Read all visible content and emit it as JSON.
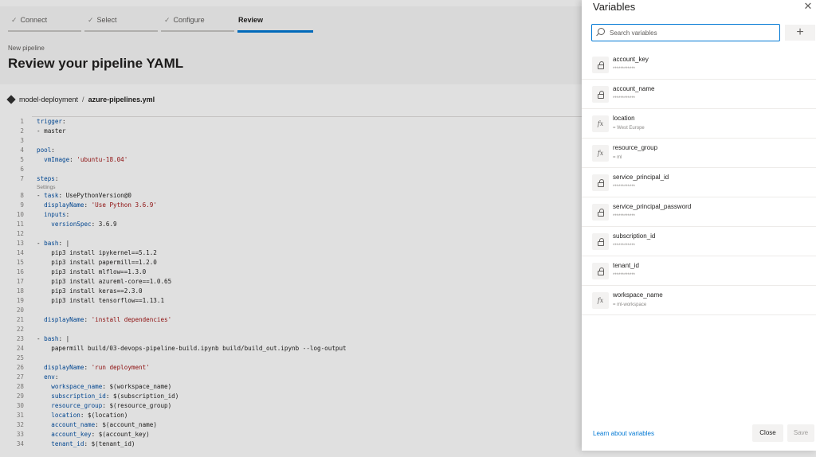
{
  "wizard": {
    "steps": [
      {
        "label": "Connect",
        "checked": true
      },
      {
        "label": "Select",
        "checked": true
      },
      {
        "label": "Configure",
        "checked": true
      },
      {
        "label": "Review",
        "checked": false
      }
    ]
  },
  "header": {
    "subtitle": "New pipeline",
    "title": "Review your pipeline YAML"
  },
  "breadcrumb": {
    "repo": "model-deployment",
    "separator": "/",
    "file": "azure-pipelines.yml"
  },
  "code": {
    "codelens": "Settings",
    "lines": [
      {
        "n": "1",
        "text": "trigger:"
      },
      {
        "n": "2",
        "text": "- master"
      },
      {
        "n": "3",
        "text": ""
      },
      {
        "n": "4",
        "text": "pool:"
      },
      {
        "n": "5",
        "text": "  vmImage: 'ubuntu-18.04'"
      },
      {
        "n": "6",
        "text": ""
      },
      {
        "n": "7",
        "text": "steps:"
      },
      {
        "n": "8",
        "text": "- task: UsePythonVersion@0"
      },
      {
        "n": "9",
        "text": "  displayName: 'Use Python 3.6.9'"
      },
      {
        "n": "10",
        "text": "  inputs:"
      },
      {
        "n": "11",
        "text": "    versionSpec: 3.6.9"
      },
      {
        "n": "12",
        "text": ""
      },
      {
        "n": "13",
        "text": "- bash: |"
      },
      {
        "n": "14",
        "text": "    pip3 install ipykernel==5.1.2"
      },
      {
        "n": "15",
        "text": "    pip3 install papermill==1.2.0"
      },
      {
        "n": "16",
        "text": "    pip3 install mlflow==1.3.0"
      },
      {
        "n": "17",
        "text": "    pip3 install azureml-core==1.0.65"
      },
      {
        "n": "18",
        "text": "    pip3 install keras==2.3.0"
      },
      {
        "n": "19",
        "text": "    pip3 install tensorflow==1.13.1"
      },
      {
        "n": "20",
        "text": ""
      },
      {
        "n": "21",
        "text": "  displayName: 'install dependencies'"
      },
      {
        "n": "22",
        "text": ""
      },
      {
        "n": "23",
        "text": "- bash: |"
      },
      {
        "n": "24",
        "text": "    papermill build/03-devops-pipeline-build.ipynb build/build_out.ipynb --log-output"
      },
      {
        "n": "25",
        "text": ""
      },
      {
        "n": "26",
        "text": "  displayName: 'run deployment'"
      },
      {
        "n": "27",
        "text": "  env:"
      },
      {
        "n": "28",
        "text": "    workspace_name: $(workspace_name)"
      },
      {
        "n": "29",
        "text": "    subscription_id: $(subscription_id)"
      },
      {
        "n": "30",
        "text": "    resource_group: $(resource_group)"
      },
      {
        "n": "31",
        "text": "    location: $(location)"
      },
      {
        "n": "32",
        "text": "    account_name: $(account_name)"
      },
      {
        "n": "33",
        "text": "    account_key: $(account_key)"
      },
      {
        "n": "34",
        "text": "    tenant_id: $(tenant_id)"
      }
    ]
  },
  "panel": {
    "title": "Variables",
    "close_icon": "close-icon",
    "search_placeholder": "Search variables",
    "add_icon": "plus-icon",
    "variables": [
      {
        "name": "account_key",
        "value": "************",
        "icon": "lock-icon"
      },
      {
        "name": "account_name",
        "value": "************",
        "icon": "lock-icon"
      },
      {
        "name": "location",
        "value": "= West Europe",
        "icon": "fx-icon"
      },
      {
        "name": "resource_group",
        "value": "= ml",
        "icon": "fx-icon"
      },
      {
        "name": "service_principal_id",
        "value": "************",
        "icon": "lock-icon"
      },
      {
        "name": "service_principal_password",
        "value": "************",
        "icon": "lock-icon"
      },
      {
        "name": "subscription_id",
        "value": "************",
        "icon": "lock-icon"
      },
      {
        "name": "tenant_id",
        "value": "************",
        "icon": "lock-icon"
      },
      {
        "name": "workspace_name",
        "value": "= ml-workspace",
        "icon": "fx-icon"
      }
    ],
    "learn_link": "Learn about variables",
    "close_label": "Close",
    "save_label": "Save"
  },
  "colors": {
    "accent": "#0078d4",
    "keyword": "#0451a5",
    "string": "#a31515"
  }
}
